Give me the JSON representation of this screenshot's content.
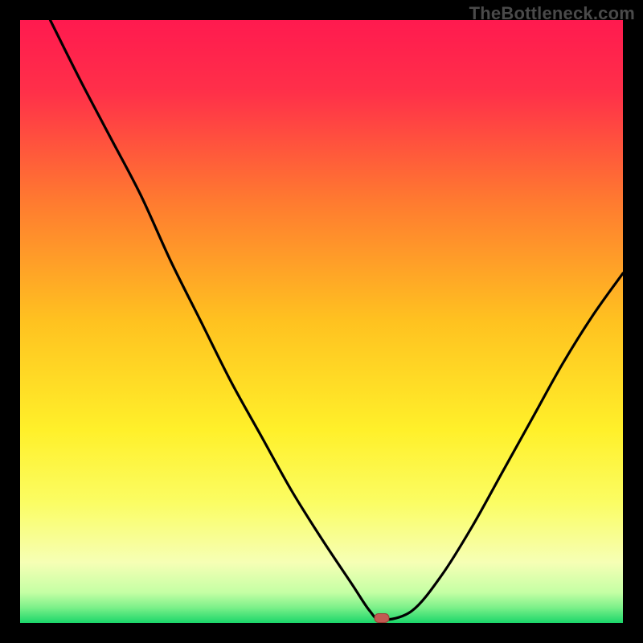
{
  "watermark": "TheBottleneck.com",
  "colors": {
    "page_bg": "#000000",
    "frame_border": "#000000",
    "curve": "#000000",
    "marker_fill": "#c25a52",
    "marker_stroke": "#9b3e37",
    "gradient_stops": [
      {
        "offset": 0.0,
        "color": "#ff1a4f"
      },
      {
        "offset": 0.12,
        "color": "#ff3049"
      },
      {
        "offset": 0.3,
        "color": "#ff7a30"
      },
      {
        "offset": 0.5,
        "color": "#ffc220"
      },
      {
        "offset": 0.68,
        "color": "#fff02a"
      },
      {
        "offset": 0.8,
        "color": "#fbfd63"
      },
      {
        "offset": 0.9,
        "color": "#f6ffb5"
      },
      {
        "offset": 0.95,
        "color": "#c4ffa4"
      },
      {
        "offset": 0.975,
        "color": "#7af089"
      },
      {
        "offset": 1.0,
        "color": "#1bd66a"
      }
    ]
  },
  "chart_data": {
    "type": "line",
    "title": "",
    "xlabel": "",
    "ylabel": "",
    "xlim": [
      0,
      100
    ],
    "ylim": [
      0,
      100
    ],
    "grid": false,
    "legend": null,
    "series": [
      {
        "name": "bottleneck-curve",
        "x": [
          5,
          10,
          15,
          20,
          25,
          30,
          35,
          40,
          45,
          50,
          55,
          58,
          60,
          65,
          70,
          75,
          80,
          85,
          90,
          95,
          100
        ],
        "y": [
          100,
          90,
          80.5,
          71,
          60,
          50,
          40,
          31,
          22,
          14,
          6.5,
          2,
          0.5,
          2,
          8,
          16,
          25,
          34,
          43,
          51,
          58
        ]
      }
    ],
    "flat_region": {
      "x_start": 56,
      "x_end": 60,
      "y": 0.5
    },
    "marker": {
      "x": 60,
      "y": 0.8
    },
    "notes": "V-shaped curve descending from top-left, reaching a short flat minimum near x≈56–60, then rising toward the right edge reaching roughly 58% height. Background is a vertical red→orange→yellow→green gradient. A small rounded reddish marker sits at the minimum."
  }
}
